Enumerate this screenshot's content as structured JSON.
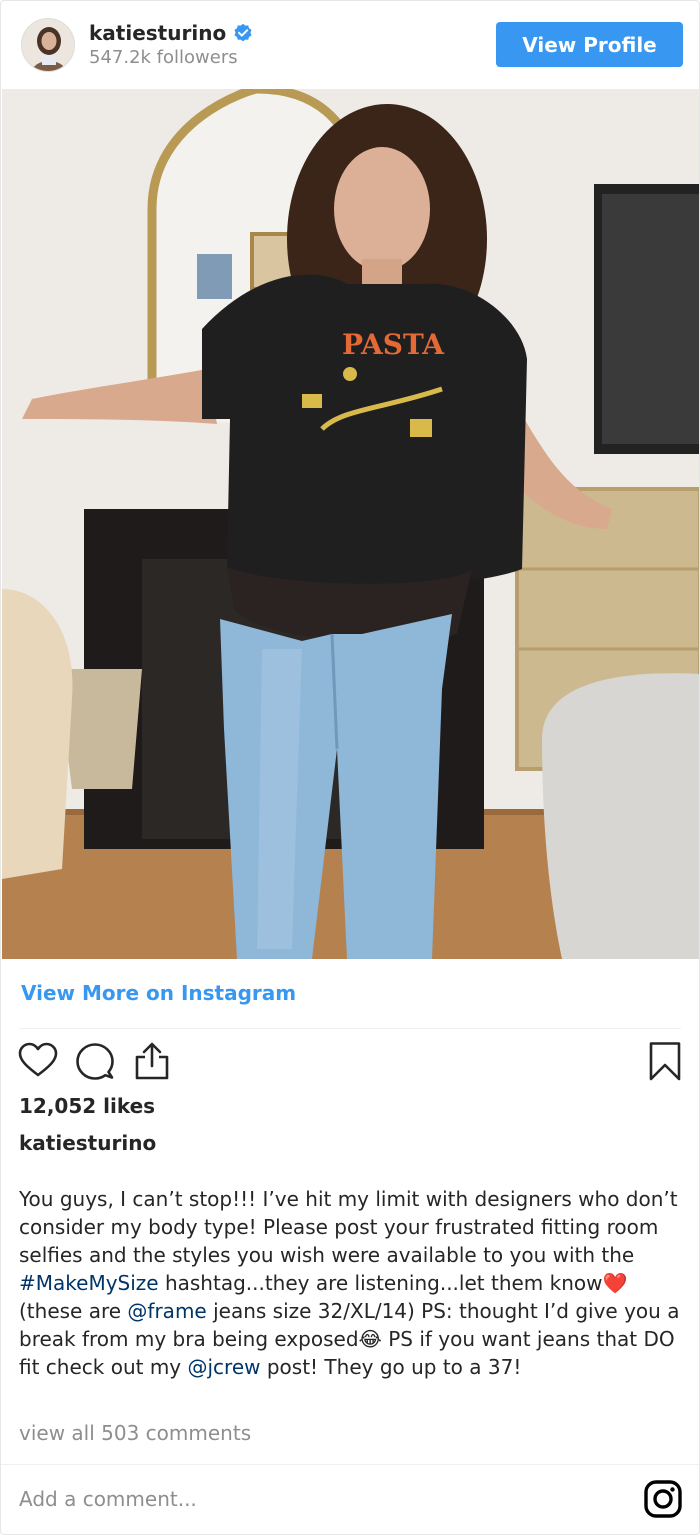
{
  "header": {
    "username": "katiesturino",
    "verified": true,
    "followers": "547.2k followers",
    "view_profile_label": "View Profile"
  },
  "post": {
    "view_more_label": "View More on Instagram",
    "likes": "12,052 likes",
    "caption_user": "katiesturino",
    "caption": {
      "part1": "You guys, I can’t stop!!! I’ve hit my limit with designers who don’t consider my body type! Please post your frustrated fitting room selfies and the styles you wish were available to you with the ",
      "hashtag": "#MakeMySize",
      "part2": " hashtag...they are listening...let them know❤️ (these are ",
      "mention1": "@frame",
      "part3": " jeans size 32/XL/14) PS: thought I’d give you a break from my bra being exposed😂 PS if you want jeans that DO fit check out my ",
      "mention2": "@jcrew",
      "part4": " post! They go up to a 37!"
    },
    "view_comments": "view all 503 comments",
    "add_comment_placeholder": "Add a comment..."
  },
  "colors": {
    "accent": "#3897f0",
    "link": "#003569",
    "muted": "#8e8e8e",
    "text": "#262626"
  },
  "icons": [
    "verified-badge-icon",
    "heart-icon",
    "comment-icon",
    "share-icon",
    "bookmark-icon",
    "instagram-logo-icon"
  ]
}
